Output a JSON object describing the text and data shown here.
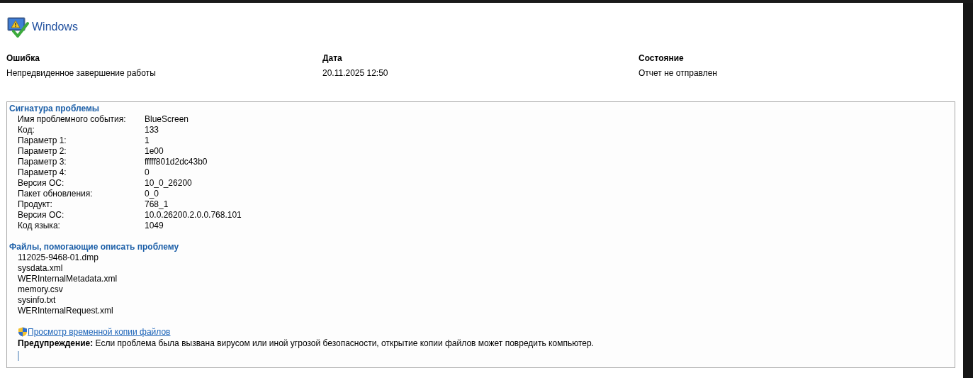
{
  "header": {
    "title": "Windows"
  },
  "summary": [
    {
      "label": "Ошибка",
      "value": "Непредвиденное завершение работы"
    },
    {
      "label": "Дата",
      "value": "20.11.2025 12:50"
    },
    {
      "label": "Состояние",
      "value": "Отчет не отправлен"
    }
  ],
  "signature": {
    "title": "Сигнатура проблемы",
    "rows": [
      {
        "name": "Имя проблемного события:",
        "value": "BlueScreen"
      },
      {
        "name": "Код:",
        "value": "133"
      },
      {
        "name": "Параметр 1:",
        "value": "1"
      },
      {
        "name": "Параметр 2:",
        "value": "1e00"
      },
      {
        "name": "Параметр 3:",
        "value": "fffff801d2dc43b0"
      },
      {
        "name": "Параметр 4:",
        "value": "0"
      },
      {
        "name": "Версия ОС:",
        "value": "10_0_26200"
      },
      {
        "name": "Пакет обновления:",
        "value": "0_0"
      },
      {
        "name": "Продукт:",
        "value": "768_1"
      },
      {
        "name": "Версия ОС:",
        "value": "10.0.26200.2.0.0.768.101"
      },
      {
        "name": "Код языка:",
        "value": "1049"
      }
    ]
  },
  "files": {
    "title": "Файлы, помогающие описать проблему",
    "items": [
      "112025-9468-01.dmp",
      "sysdata.xml",
      "WERInternalMetadata.xml",
      "memory.csv",
      "sysinfo.txt",
      "WERInternalRequest.xml"
    ]
  },
  "view_link": "Просмотр временной копии файлов",
  "warning": "**Предупреждение:** Если проблема была вызвана вирусом или иной угрозой безопасности, открытие копии файлов может повредить компьютер."
}
